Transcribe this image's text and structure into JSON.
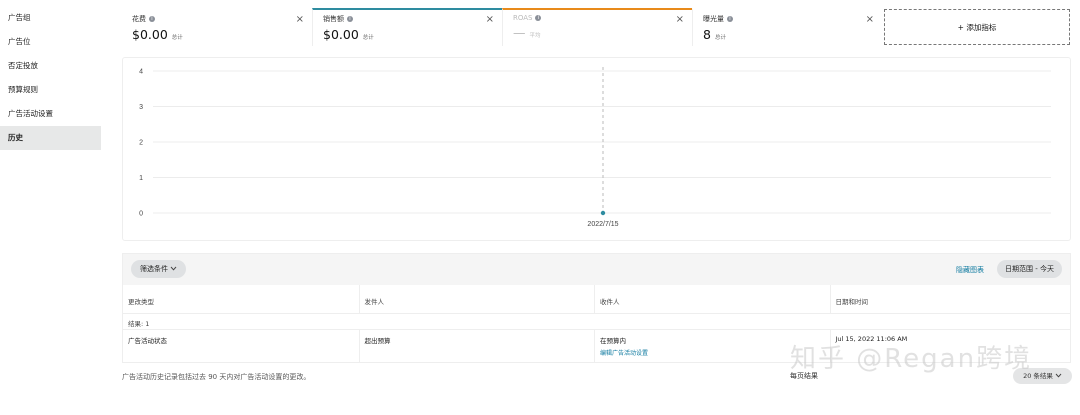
{
  "sidebar": {
    "items": [
      {
        "label": "广告组",
        "active": false
      },
      {
        "label": "广告位",
        "active": false
      },
      {
        "label": "否定投放",
        "active": false
      },
      {
        "label": "预算规则",
        "active": false
      },
      {
        "label": "广告活动设置",
        "active": false
      },
      {
        "label": "历史",
        "active": true
      }
    ]
  },
  "metrics": {
    "cards": [
      {
        "title": "花费",
        "value": "$0.00",
        "unit": "总计"
      },
      {
        "title": "销售额",
        "value": "$0.00",
        "unit": "总计"
      },
      {
        "title": "ROAS",
        "value": "—",
        "unit": "平均"
      },
      {
        "title": "曝光量",
        "value": "8",
        "unit": "总计"
      }
    ],
    "add_label": "+ 添加指标",
    "close_glyph": "×",
    "info_glyph": "i",
    "colors": {
      "sales": "#2e8ca0",
      "roas": "#e88a1a"
    }
  },
  "chart_data": {
    "type": "line",
    "y_ticks": [
      "4",
      "3",
      "2",
      "1",
      "0"
    ],
    "ylim": [
      0,
      4
    ],
    "x": [
      "2022/7/15"
    ],
    "series": [
      {
        "values": [
          0
        ],
        "color": "#2e8ca0"
      }
    ],
    "grid": true
  },
  "filter": {
    "button_label": "筛选条件",
    "hide_chart": "隐藏图表",
    "date_range": "日期范围 - 今天"
  },
  "table": {
    "headers": [
      "更改类型",
      "发件人",
      "收件人",
      "日期和时间"
    ],
    "results": "结果: 1",
    "rows": [
      {
        "change_type": "广告活动状态",
        "from": "超出预算",
        "to": "在预算内",
        "to_link": "编辑广告活动设置",
        "datetime": "Jul 15, 2022 11:06 AM"
      }
    ]
  },
  "footnote": "广告活动历史记录包括过去 90 天内对广告活动设置的更改。",
  "pager": {
    "label": "每页结果",
    "select_value": "20 条结果"
  },
  "watermark": "知乎 @Regan跨境"
}
